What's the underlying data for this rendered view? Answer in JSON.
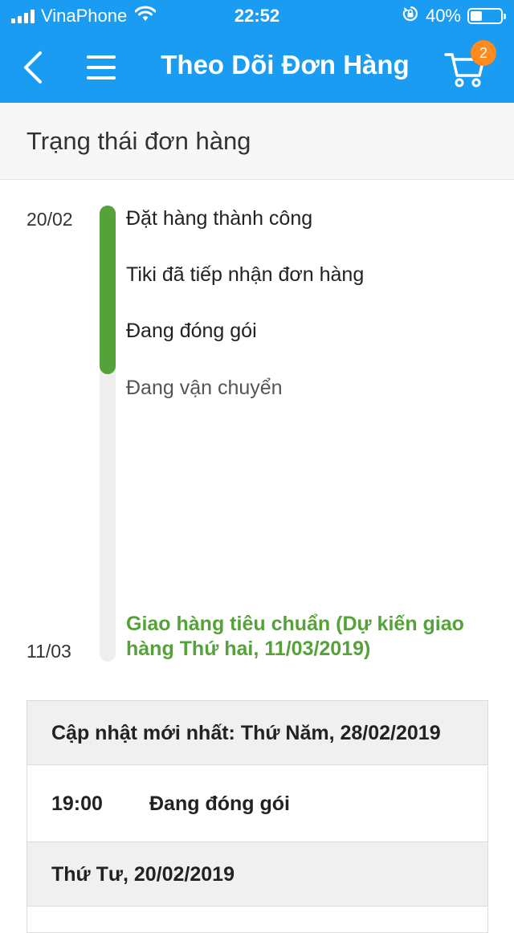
{
  "status_bar": {
    "carrier": "VinaPhone",
    "time": "22:52",
    "battery": "40%",
    "battery_level": 0.4
  },
  "nav": {
    "title": "Theo Dõi Đơn Hàng",
    "cart_count": "2"
  },
  "section": {
    "title": "Trạng thái đơn hàng"
  },
  "timeline": {
    "start_date": "20/02",
    "end_date": "11/03",
    "steps": [
      {
        "label": "Đặt hàng thành công",
        "done": true
      },
      {
        "label": "Tiki đã tiếp nhận đơn hàng",
        "done": true
      },
      {
        "label": "Đang đóng gói",
        "done": true
      },
      {
        "label": "Đang vận chuyển",
        "done": false
      }
    ],
    "delivery": "Giao hàng tiêu chuẩn (Dự kiến giao hàng Thứ hai, 11/03/2019)",
    "progress_color": "#56a23a"
  },
  "updates": {
    "latest_header": "Cập nhật mới nhất: Thứ Năm, 28/02/2019",
    "rows": [
      {
        "time": "19:00",
        "event": "Đang đóng gói"
      }
    ],
    "date_header": "Thứ Tư, 20/02/2019"
  },
  "colors": {
    "header_blue": "#1a9cf2",
    "badge_orange": "#ff8a1e",
    "accent_green": "#56a23a"
  }
}
